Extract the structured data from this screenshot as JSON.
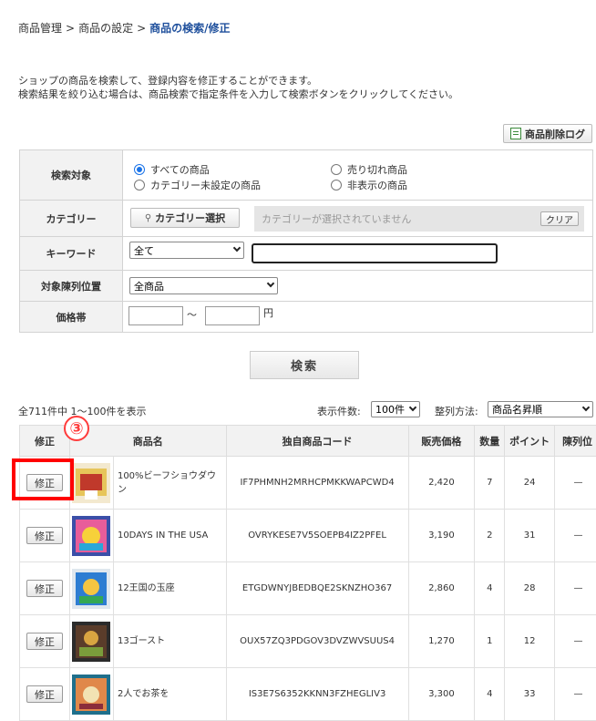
{
  "breadcrumb": {
    "item1": "商品管理",
    "item2": "商品の設定",
    "current": "商品の検索/修正",
    "sep": ">"
  },
  "description": {
    "line1": "ショップの商品を検索して、登録内容を修正することができます。",
    "line2": "検索結果を絞り込む場合は、商品検索で指定条件を入力して検索ボタンをクリックしてください。"
  },
  "delete_log_label": "商品削除ログ",
  "search": {
    "target_label": "検索対象",
    "targets": [
      {
        "label": "すべての商品",
        "selected": true
      },
      {
        "label": "売り切れ商品",
        "selected": false
      },
      {
        "label": "カテゴリー未設定の商品",
        "selected": false
      },
      {
        "label": "非表示の商品",
        "selected": false
      }
    ],
    "category_label": "カテゴリー",
    "category_button": "カテゴリー選択",
    "category_placeholder": "カテゴリーが選択されていません",
    "clear_button": "クリア",
    "keyword_label": "キーワード",
    "keyword_scope": "全て",
    "keyword_value": "",
    "position_label": "対象陳列位置",
    "position_value": "全商品",
    "price_label": "価格帯",
    "price_sep": "〜",
    "price_unit": "円",
    "search_button": "検索"
  },
  "results": {
    "count_text": "全711件中 1〜100件を表示",
    "display_label": "表示件数:",
    "display_value": "100件",
    "sort_label": "整列方法:",
    "sort_value": "商品名昇順",
    "headers": [
      "修正",
      "商品名",
      "独自商品コード",
      "販売価格",
      "数量",
      "ポイント",
      "陳列位"
    ],
    "edit_label": "修正",
    "dash": "—",
    "rows": [
      {
        "name": "100%ビーフショウダウン",
        "code": "IF7PHMNH2MRHCPMKKWAPCWD4",
        "price": "2,420",
        "qty": "7",
        "points": "24"
      },
      {
        "name": "10DAYS IN THE USA",
        "code": "OVRYKESE7V5SOEPB4IZ2PFEL",
        "price": "3,190",
        "qty": "2",
        "points": "31"
      },
      {
        "name": "12王国の玉座",
        "code": "ETGDWNYJBEDBQE2SKNZHO367",
        "price": "2,860",
        "qty": "4",
        "points": "28"
      },
      {
        "name": "13ゴースト",
        "code": "OUX57ZQ3PDGOV3DVZWVSUUS4",
        "price": "1,270",
        "qty": "1",
        "points": "12"
      },
      {
        "name": "2人でお茶を",
        "code": "IS3E7S6352KKNN3FZHEGLIV3",
        "price": "3,300",
        "qty": "4",
        "points": "33"
      }
    ]
  },
  "annotation": {
    "number": "③",
    "color": "#ff3b3b"
  }
}
